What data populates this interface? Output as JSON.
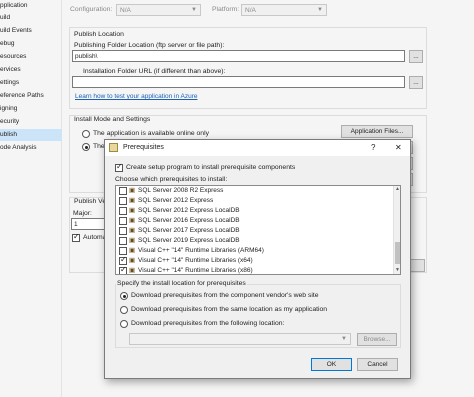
{
  "nav": {
    "items": [
      "pplication",
      "uild",
      "uild Events",
      "ebug",
      "esources",
      "ervices",
      "ettings",
      "eference Paths",
      "igning",
      "ecurity",
      "ublish",
      "ode Analysis"
    ],
    "active_index": 10
  },
  "top": {
    "configuration_label": "Configuration:",
    "configuration_value": "N/A",
    "platform_label": "Platform:",
    "platform_value": "N/A"
  },
  "publish_location": {
    "header": "Publish Location",
    "folder_label": "Publishing Folder Location (ftp server or file path):",
    "folder_value": "publish\\",
    "browse_label": "...",
    "install_url_label": "Installation Folder URL (if different than above):",
    "install_url_value": "",
    "install_browse_label": "...",
    "link_text": "Learn how to test your application in Azure"
  },
  "install_mode": {
    "header": "Install Mode and Settings",
    "online_only": "The application is available online only",
    "offline_truncated": "The",
    "app_files_button": "Application Files..."
  },
  "publish_version": {
    "header_truncated": "Publish Ve",
    "major_label": "Major:",
    "major_value": "1",
    "auto_truncated": "Automa"
  },
  "dialog": {
    "title": "Prerequisites",
    "help_glyph": "?",
    "close_glyph": "✕",
    "create_setup_label": "Create setup program to install prerequisite components",
    "choose_label": "Choose which prerequisites to install:",
    "items": [
      {
        "label": "SQL Server 2008 R2 Express",
        "checked": false
      },
      {
        "label": "SQL Server 2012 Express",
        "checked": false
      },
      {
        "label": "SQL Server 2012 Express LocalDB",
        "checked": false
      },
      {
        "label": "SQL Server 2016 Express LocalDB",
        "checked": false
      },
      {
        "label": "SQL Server 2017 Express LocalDB",
        "checked": false
      },
      {
        "label": "SQL Server 2019 Express LocalDB",
        "checked": false
      },
      {
        "label": "Visual C++ \"14\" Runtime Libraries (ARM64)",
        "checked": false
      },
      {
        "label": "Visual C++ \"14\" Runtime Libraries (x64)",
        "checked": true
      },
      {
        "label": "Visual C++ \"14\" Runtime Libraries (x86)",
        "checked": true
      }
    ],
    "location_header": "Specify the install location for prerequisites",
    "loc_vendor": "Download prerequisites from the component vendor's web site",
    "loc_same": "Download prerequisites from the same location as my application",
    "loc_following": "Download prerequisites from the following location:",
    "browse_button": "Browse...",
    "ok_button": "OK",
    "cancel_button": "Cancel"
  }
}
